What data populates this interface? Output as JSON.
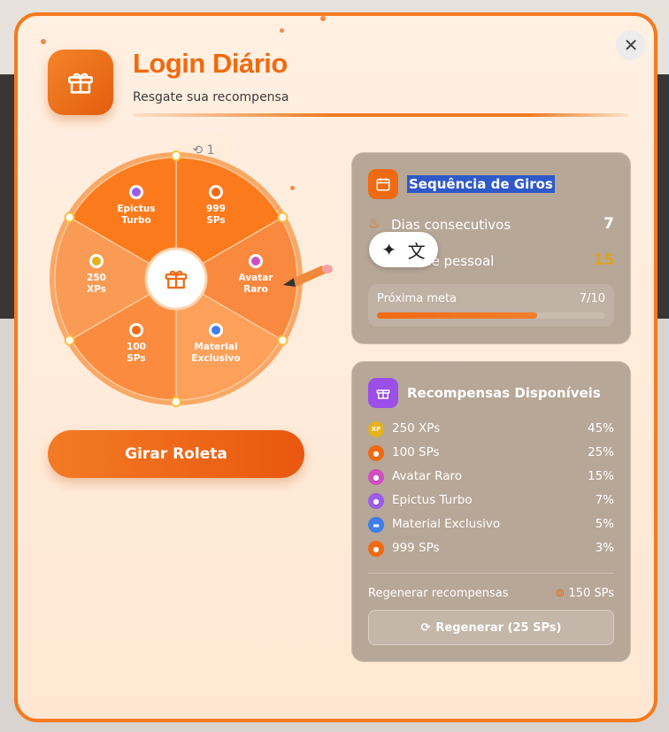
{
  "header": {
    "title": "Login Diário",
    "subtitle": "Resgate sua recompensa"
  },
  "wheel": {
    "segments": [
      {
        "label": "999\nSPs",
        "icon": "orange-ring",
        "color": "#fb7a1c"
      },
      {
        "label": "Avatar\nRaro",
        "icon": "pink-orb",
        "color": "#f9893f"
      },
      {
        "label": "Material\nExclusivo",
        "icon": "blue-pill",
        "color": "#fca05a"
      },
      {
        "label": "100\nSPs",
        "icon": "orange-ring",
        "color": "#fb8c3f"
      },
      {
        "label": "250\nXPs",
        "icon": "xp-coin",
        "color": "#fa9b55"
      },
      {
        "label": "Epictus\nTurbo",
        "icon": "purple-orb",
        "color": "#fb7a1c"
      }
    ],
    "center_icon": "gift-icon",
    "pointer_icon": "pencil-pointer-icon",
    "refresh_text": "1"
  },
  "spin_button": "Girar Roleta",
  "streak": {
    "title": "Sequência de Giros",
    "consecutive_label": "Dias consecutivos",
    "consecutive_value": "7",
    "record_label": "de pessoal",
    "record_value": "15",
    "goal_label": "Próxima meta",
    "goal_value": "7/10",
    "goal_progress": 0.7
  },
  "rewards": {
    "title": "Recompensas Disponíveis",
    "items": [
      {
        "name": "250 XPs",
        "pct": "45%",
        "icon": "xp-coin-icon"
      },
      {
        "name": "100 SPs",
        "pct": "25%",
        "icon": "sp-coin-icon"
      },
      {
        "name": "Avatar Raro",
        "pct": "15%",
        "icon": "avatar-orb-icon"
      },
      {
        "name": "Epictus Turbo",
        "pct": "7%",
        "icon": "turbo-orb-icon"
      },
      {
        "name": "Material Exclusivo",
        "pct": "5%",
        "icon": "material-icon"
      },
      {
        "name": "999 SPs",
        "pct": "3%",
        "icon": "sp-coin-icon"
      }
    ],
    "regen_label": "Regenerar recompensas",
    "regen_cost": "150 SPs",
    "regen_button": "Regenerar (25 SPs)"
  },
  "colors": {
    "accent": "#f06a12",
    "card_bg": "#b7a797",
    "record_value": "#e0a21a"
  }
}
